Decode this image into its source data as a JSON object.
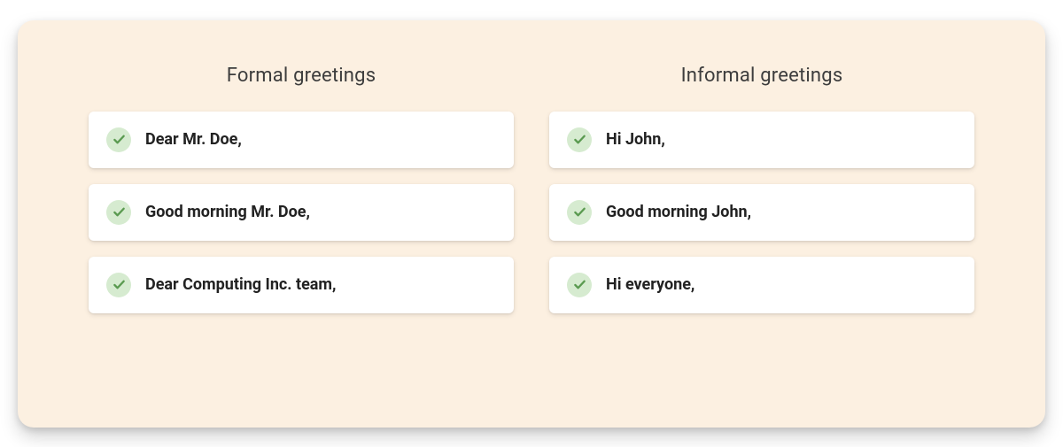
{
  "columns": [
    {
      "title": "Formal greetings",
      "items": [
        "Dear Mr. Doe,",
        "Good morning Mr. Doe,",
        "Dear Computing Inc. team,"
      ]
    },
    {
      "title": "Informal greetings",
      "items": [
        "Hi John,",
        "Good morning John,",
        "Hi everyone,"
      ]
    }
  ],
  "colors": {
    "card_background": "#fcf0e1",
    "item_background": "#ffffff",
    "check_circle": "#d6ebd0",
    "check_stroke": "#5a9a50",
    "title_text": "#3d3d3d",
    "item_text": "#222222"
  }
}
